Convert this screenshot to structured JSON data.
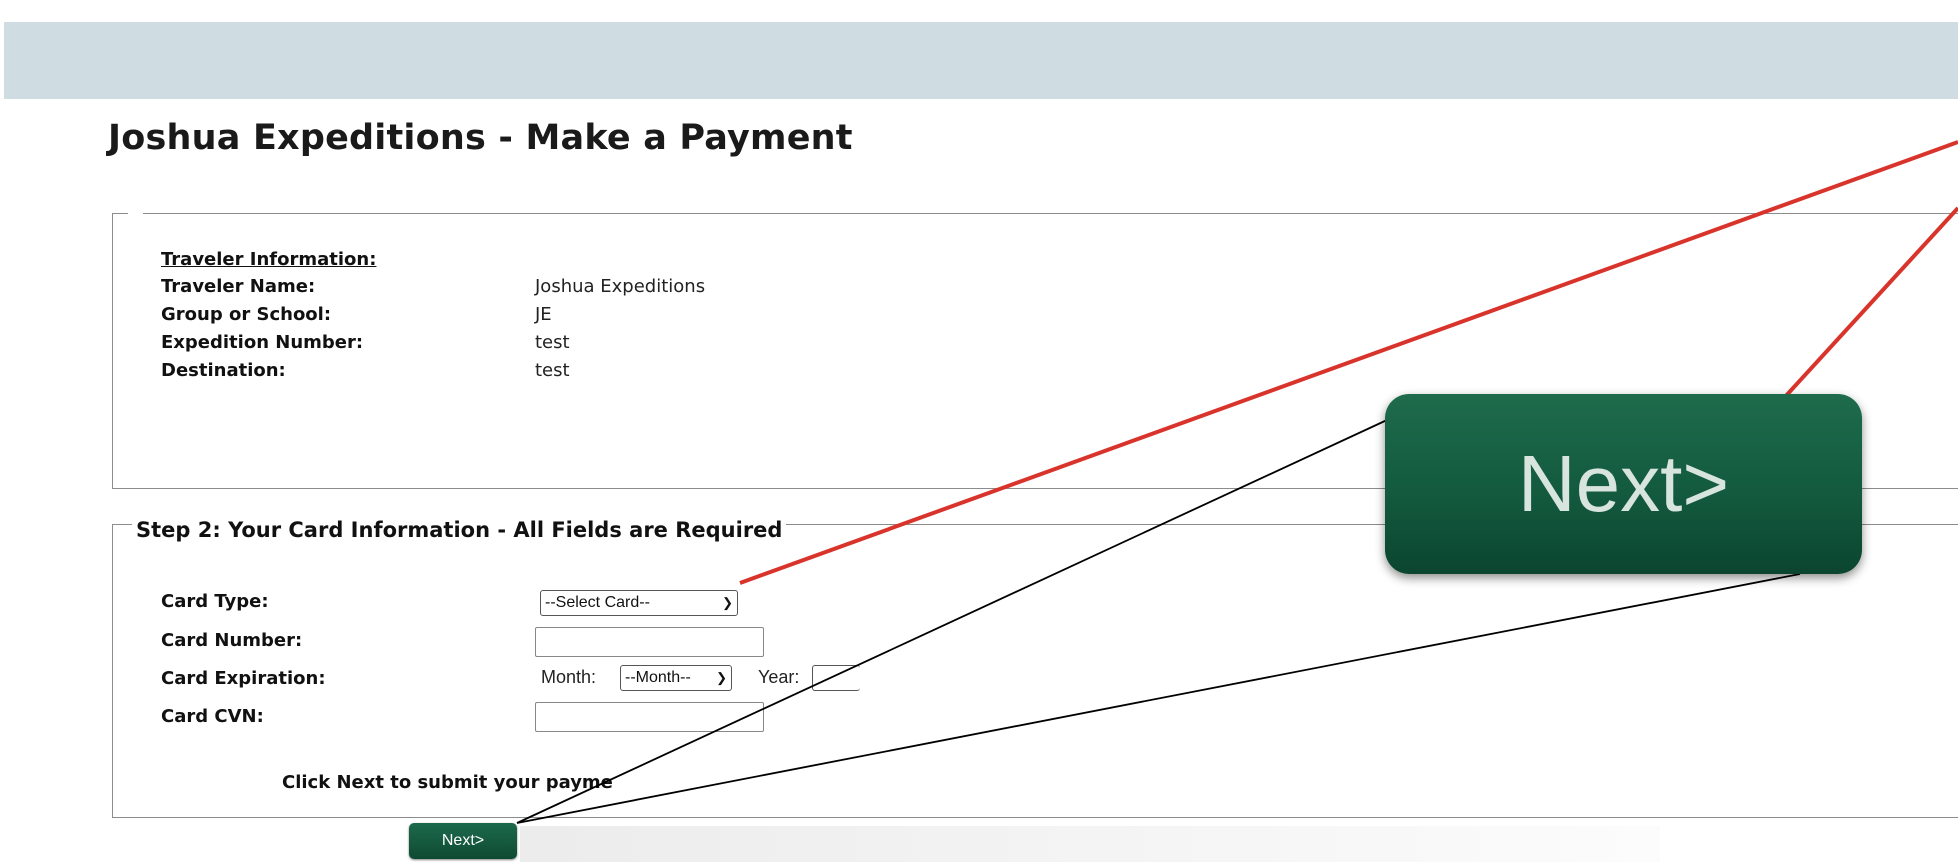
{
  "page": {
    "title": "Joshua Expeditions - Make a Payment"
  },
  "traveler": {
    "heading": "Traveler Information:",
    "rows": [
      {
        "label": "Traveler Name:",
        "value": "Joshua  Expeditions"
      },
      {
        "label": "Group or School:",
        "value": "JE"
      },
      {
        "label": "Expedition Number:",
        "value": "test"
      },
      {
        "label": "Destination:",
        "value": "test"
      }
    ]
  },
  "card": {
    "legend": "Step 2: Your Card Information - All Fields are Required",
    "type_label": "Card Type:",
    "type_selected": "--Select Card--",
    "number_label": "Card Number:",
    "expiration_label": "Card Expiration:",
    "month_label": "Month:",
    "month_selected": "--Month--",
    "year_label": "Year:",
    "cvn_label": "Card CVN:",
    "instruction": "Click Next to submit your payme"
  },
  "next_button": {
    "label": "Next>"
  },
  "next_zoom": {
    "label": "Next>"
  },
  "colors": {
    "header_band": "#cfdde3",
    "button_green": "#135a3e",
    "annotation_red": "#d9342b"
  }
}
